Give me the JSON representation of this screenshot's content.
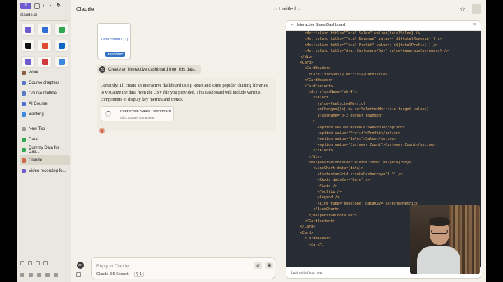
{
  "sidebar": {
    "url": "claude.ai",
    "tiles": [
      {
        "label": "",
        "color": "#6d5bd0",
        "icon": "circle-app-icon"
      },
      {
        "label": "",
        "color": "#2f6fd6",
        "icon": "screen-app-icon"
      },
      {
        "label": "",
        "color": "#2fa84f",
        "icon": "check-app-icon"
      },
      {
        "label": "",
        "color": "#111111",
        "icon": "x-app-icon"
      },
      {
        "label": "",
        "color": "#e04a2f",
        "icon": "spiral-app-icon"
      },
      {
        "label": "",
        "color": "#0a66c2",
        "icon": "linkedin-app-icon"
      },
      {
        "label": "",
        "color": "#6d5bd0",
        "icon": "s-app-icon"
      },
      {
        "label": "",
        "color": "#d23b3b",
        "icon": "gmail-app-icon"
      },
      {
        "label": "",
        "color": "#3a88e0",
        "icon": "play-app-icon"
      }
    ],
    "items": [
      {
        "label": "Work",
        "color": "#8b5e3c"
      },
      {
        "label": "Course chapters",
        "color": "#5a79c7"
      },
      {
        "label": "Course Outline",
        "color": "#5a79c7"
      },
      {
        "label": "AI Course",
        "color": "#4d6fd1"
      },
      {
        "label": "Banking",
        "color": "#3a88e0"
      },
      {
        "label": "New Tab",
        "color": "#999999"
      },
      {
        "label": "Data",
        "color": "#2fa84f"
      },
      {
        "label": "Dummy Data for Das...",
        "color": "#2fa84f"
      },
      {
        "label": "Claude",
        "color": "#d2694b"
      },
      {
        "label": "Video recording fo...",
        "color": "#6d5bd0"
      }
    ]
  },
  "header": {
    "app_title": "Claude",
    "doc_title": "Untitled",
    "chevron": "⌄",
    "star": "☆"
  },
  "chat": {
    "file_name": "Data Sheet1 (1)",
    "file_badge": "TEXT/CSV",
    "user_initials": "ZK",
    "user_message": "Create an interactive dashboard from this data.",
    "reply": "Certainly! I'll create an interactive dashboard using React and some popular charting libraries to visualize the data from the CSV file you provided. This dashboard will include various components to display key metrics and trends.",
    "artifact_title": "Interactive Sales Dashboard",
    "artifact_subtitle": "Click to open component",
    "input_placeholder": "Reply to Claude...",
    "model": "Claude 3.5 Sonnet",
    "model_badge": "1"
  },
  "panel": {
    "title": "Interactive Sales Dashboard",
    "footer": "Last edited just now",
    "code_lines": [
      "      <MetricCard title=\"Total Sales\" value={totalSales} />",
      "      <MetricCard title=\"Total Revenue\" value={`$${totalRevenue}`} />",
      "      <MetricCard title=\"Total Profit\" value={`$${totalProfit}`} />",
      "      <MetricCard title=\"Avg. Customers/Day\" value={averageCustomers} />",
      "    </div>",
      "",
      "    <Card>",
      "      <CardHeader>",
      "        <CardTitle>Daily Metrics</CardTitle>",
      "      </CardHeader>",
      "      <CardContent>",
      "        <div className=\"mb-4\">",
      "          <select",
      "            value={selectedMetric}",
      "            onChange={(e) => setSelectedMetric(e.target.value)}",
      "            className=\"p-2 border rounded\"",
      "          >",
      "            <option value=\"Revenue\">Revenue</option>",
      "            <option value=\"Profit\">Profit</option>",
      "            <option value=\"Sales\">Sales</option>",
      "            <option value=\"Customer_Count\">Customer Count</option>",
      "          </select>",
      "        </div>",
      "        <ResponsiveContainer width=\"100%\" height={300}>",
      "          <LineChart data={data}>",
      "            <CartesianGrid strokeDasharray=\"3 3\" />",
      "            <XAxis dataKey=\"Date\" />",
      "            <YAxis />",
      "            <Tooltip />",
      "            <Legend />",
      "            <Line type=\"monotone\" dataKey={selectedMetric}",
      "          </LineChart>",
      "        </ResponsiveContainer>",
      "      </CardContent>",
      "    </Card>",
      "",
      "    <Card>",
      "      <CardHeader>",
      "        <CardTi"
    ]
  }
}
